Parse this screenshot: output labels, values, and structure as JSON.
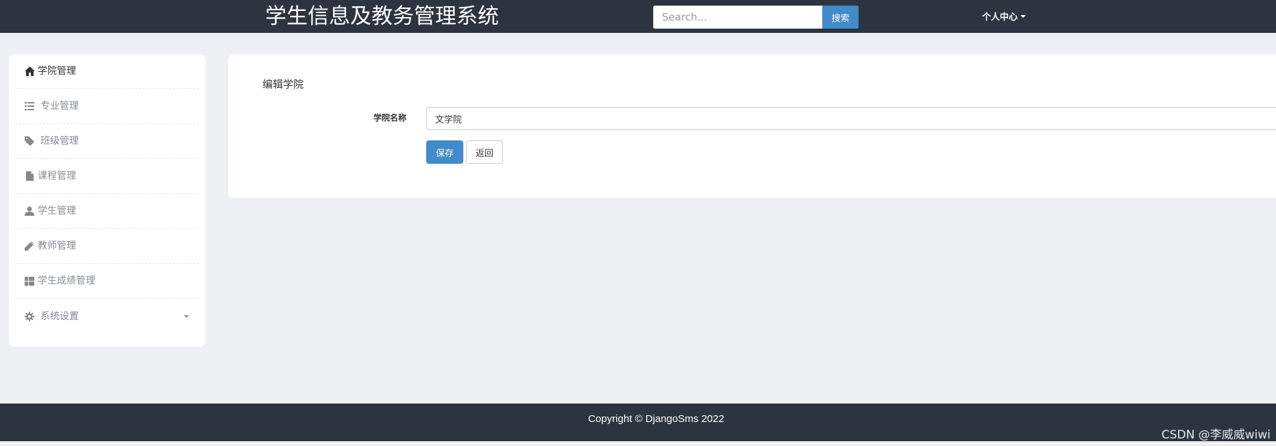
{
  "header": {
    "brand": "学生信息及教务管理系统",
    "search_placeholder": "Search...",
    "search_button": "搜索",
    "user_menu": "个人中心"
  },
  "sidebar": {
    "items": [
      {
        "label": "学院管理",
        "icon": "home-icon",
        "active": true
      },
      {
        "label": "专业管理",
        "icon": "list-icon",
        "active": false
      },
      {
        "label": "班级管理",
        "icon": "tag-icon",
        "active": false
      },
      {
        "label": "课程管理",
        "icon": "file-icon",
        "active": false
      },
      {
        "label": "学生管理",
        "icon": "user-icon",
        "active": false
      },
      {
        "label": "教师管理",
        "icon": "pencil-icon",
        "active": false
      },
      {
        "label": "学生成绩管理",
        "icon": "grid-icon",
        "active": false
      },
      {
        "label": "系统设置",
        "icon": "gear-icon",
        "active": false,
        "has_submenu": true
      }
    ]
  },
  "form": {
    "title": "编辑学院",
    "field_label": "学院名称",
    "field_value": "文学院",
    "save_label": "保存",
    "back_label": "返回"
  },
  "footer": {
    "copyright": "Copyright © DjangoSms 2022"
  },
  "watermark": "CSDN @李威威wiwi",
  "colors": {
    "navbar_bg": "#2c3440",
    "page_bg": "#eef0f4",
    "primary": "#428bca"
  }
}
